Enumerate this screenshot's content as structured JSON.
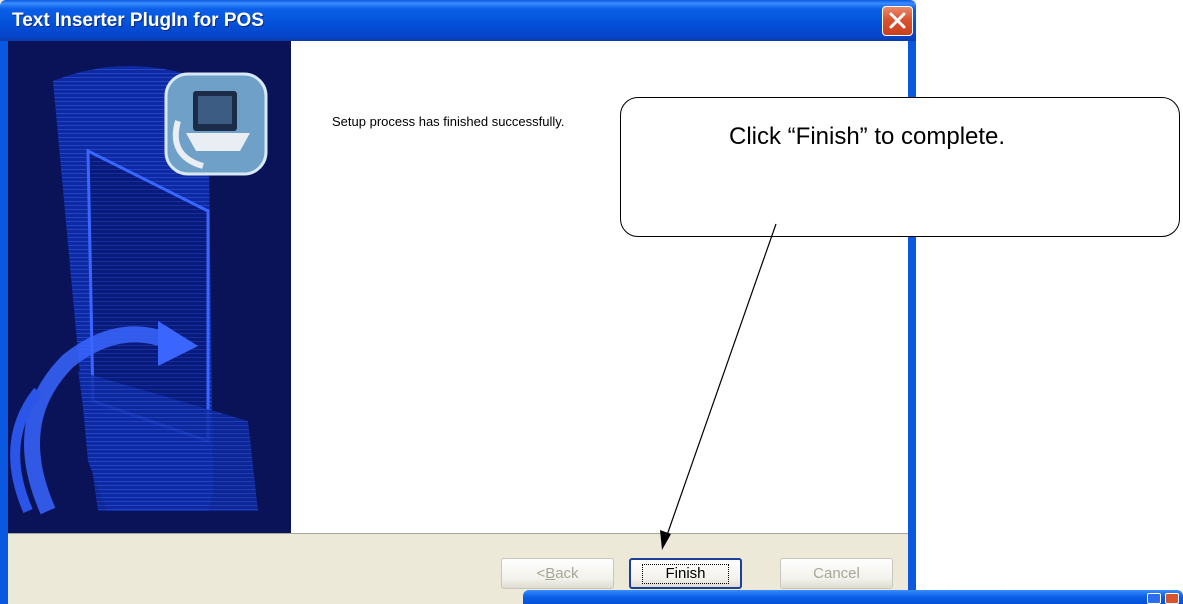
{
  "window": {
    "title": "Text Inserter PlugIn for POS"
  },
  "wizard": {
    "message": "Setup process has finished successfully."
  },
  "buttons": {
    "back_prefix": "< ",
    "back_mnemonic": "B",
    "back_rest": "ack",
    "finish": "Finish",
    "cancel": "Cancel"
  },
  "callout": {
    "text": "Click “Finish” to complete."
  },
  "icons": {
    "close": "close-icon",
    "installer": "installer-monitor-icon"
  },
  "colors": {
    "titlebar": "#0a58e0",
    "banner": "#0a1357",
    "close": "#d9532f",
    "dialog_face": "#ece9d8"
  }
}
